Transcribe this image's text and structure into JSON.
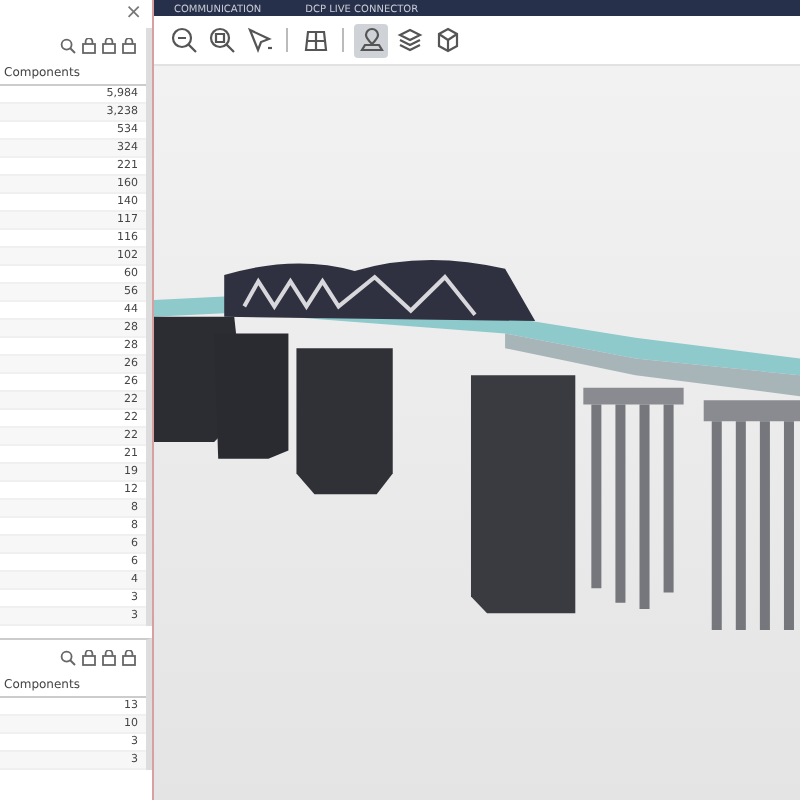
{
  "close": "×",
  "top_tabs": [
    {
      "label": "COMMUNICATION"
    },
    {
      "label": "DCP LIVE CONNECTOR"
    }
  ],
  "panels": [
    {
      "column": "Components",
      "rows": [
        "5,984",
        "3,238",
        "534",
        "324",
        "221",
        "160",
        "140",
        "117",
        "116",
        "102",
        "60",
        "56",
        "44",
        "28",
        "28",
        "26",
        "26",
        "22",
        "22",
        "22",
        "21",
        "19",
        "12",
        "8",
        "8",
        "6",
        "6",
        "4",
        "3",
        "3"
      ]
    },
    {
      "column": "Components",
      "rows": [
        "13",
        "10",
        "3",
        "3"
      ]
    }
  ],
  "toolbar": [
    {
      "kind": "zoom-out",
      "selected": false
    },
    {
      "kind": "zoom-fit",
      "selected": false
    },
    {
      "kind": "select",
      "selected": false
    },
    {
      "kind": "grid",
      "selected": false
    },
    {
      "kind": "pin",
      "selected": true
    },
    {
      "kind": "layers",
      "selected": false
    },
    {
      "kind": "cube",
      "selected": false
    }
  ]
}
